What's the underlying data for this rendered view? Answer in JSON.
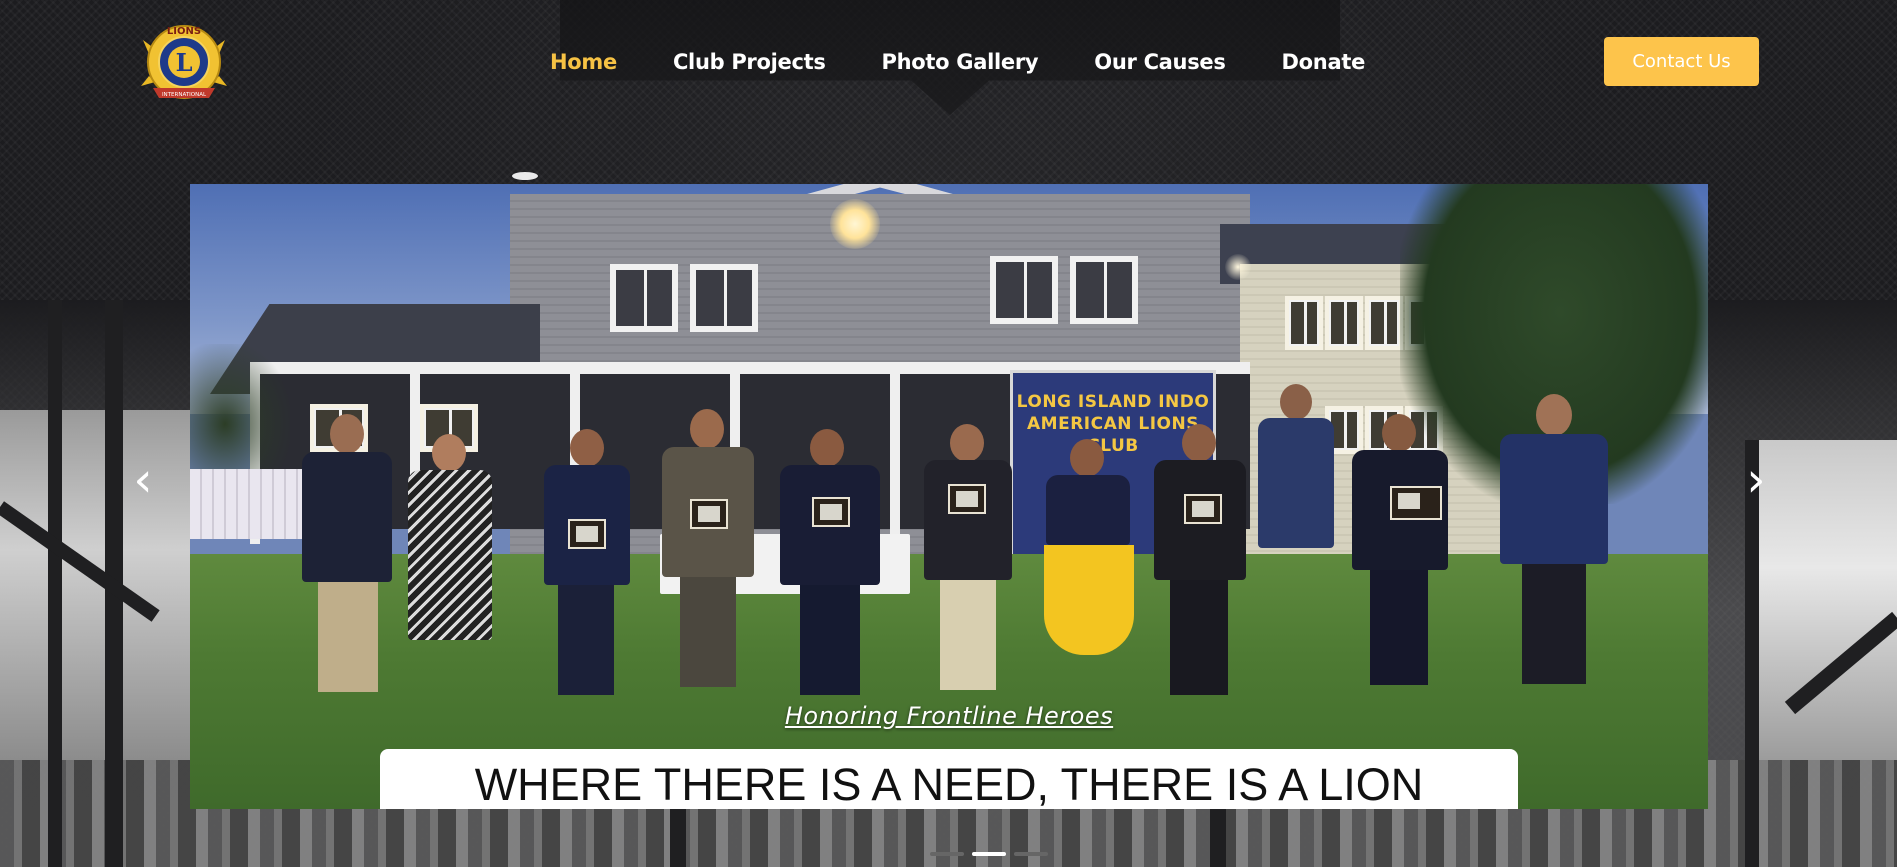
{
  "header": {
    "logo_alt": "Lions International",
    "nav": [
      {
        "label": "Home",
        "active": true
      },
      {
        "label": "Club Projects",
        "active": false
      },
      {
        "label": "Photo Gallery",
        "active": false
      },
      {
        "label": "Our Causes",
        "active": false
      },
      {
        "label": "Donate",
        "active": false
      }
    ],
    "contact_label": "Contact Us"
  },
  "hero": {
    "banner_text": "LONG ISLAND INDO AMERICAN LIONS CLUB",
    "subtitle": "Honoring Frontline Heroes",
    "title": "WHERE THERE IS A NEED, THERE IS A LION",
    "prev_arrow": "‹",
    "next_arrow": "›",
    "slide_count": 3,
    "active_slide": 2
  },
  "logo": {
    "top_text": "LIONS",
    "letter": "L",
    "bottom_text": "INTERNATIONAL"
  },
  "colors": {
    "accent": "#f6c244",
    "button": "#fdc44b",
    "background": "#1c1c1f",
    "banner_blue": "#2c3a7a"
  },
  "icons": {
    "prev": "chevron-left-icon",
    "next": "chevron-right-icon"
  }
}
